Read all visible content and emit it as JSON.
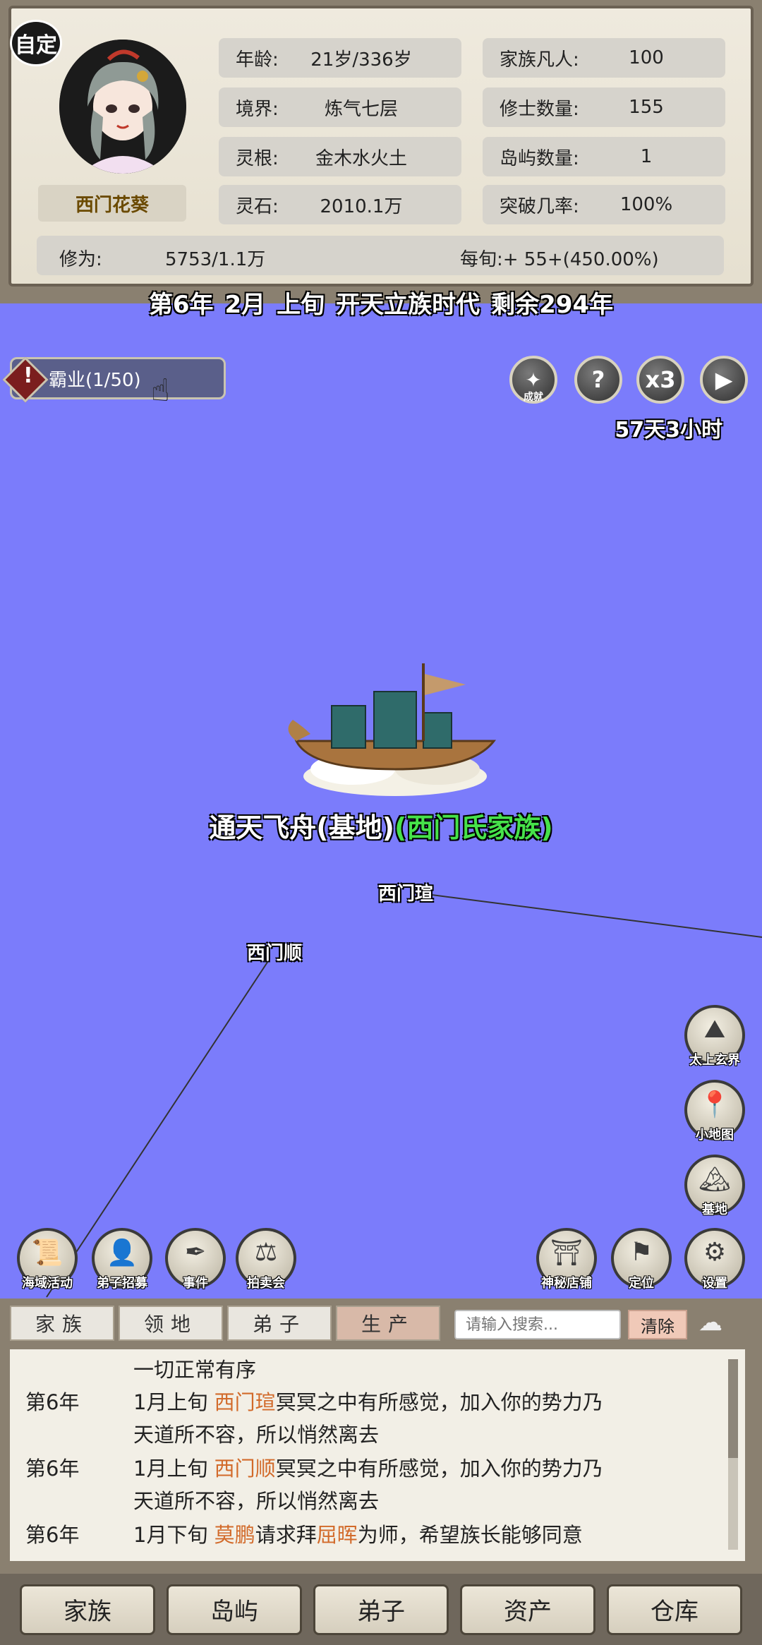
{
  "profile": {
    "custom_badge": "自定",
    "name": "西门花葵"
  },
  "stats": {
    "age_label": "年龄:",
    "age_value": "21岁/336岁",
    "realm_label": "境界:",
    "realm_value": "炼气七层",
    "root_label": "灵根:",
    "root_value": "金木水火土",
    "stone_label": "灵石:",
    "stone_value": "2010.1万",
    "mortals_label": "家族凡人:",
    "mortals_value": "100",
    "cultivators_label": "修士数量:",
    "cultivators_value": "155",
    "islands_label": "岛屿数量:",
    "islands_value": "1",
    "breakthrough_label": "突破几率:",
    "breakthrough_value": "100%",
    "cultivation_label": "修为:",
    "cultivation_value": "5753/1.1万",
    "per_period_label": "每旬:+ 55+(450.00%)"
  },
  "date": {
    "year": "第6年",
    "month": "2月",
    "period": "上旬",
    "era": "开天立族时代",
    "remaining": "剩余294年"
  },
  "quest": {
    "label": "霸业(1/50)"
  },
  "top_buttons": {
    "achievement_caption": "成就",
    "help_symbol": "?",
    "speed": "x3",
    "play_symbol": "▶",
    "timer": "57天3小时"
  },
  "map": {
    "base_name": "通天飞舟(基地)",
    "clan_name": "(西门氏家族)",
    "npc_1": "西门瑄",
    "npc_2": "西门顺"
  },
  "side_buttons": {
    "realm": "太上玄界",
    "minimap": "小地图",
    "base": "基地"
  },
  "action_buttons": {
    "sea_activity": "海域活动",
    "recruit": "弟子招募",
    "events": "事件",
    "auction": "拍卖会",
    "shop": "神秘店铺",
    "locate": "定位",
    "settings": "设置"
  },
  "log_tabs": [
    "家族",
    "领地",
    "弟子",
    "生产"
  ],
  "search": {
    "placeholder": "请输入搜索...",
    "clear": "清除"
  },
  "log": {
    "line0": "一切正常有序",
    "row1_year": "第6年",
    "row1_a": "1月上旬 ",
    "row1_name": "西门瑄",
    "row1_b": "冥冥之中有所感觉，加入你的势力乃",
    "row1_c": "天道所不容，所以悄然离去",
    "row2_year": "第6年",
    "row2_a": "1月上旬 ",
    "row2_name": "西门顺",
    "row2_b": "冥冥之中有所感觉，加入你的势力乃",
    "row2_c": "天道所不容，所以悄然离去",
    "row3_year": "第6年",
    "row3_a": "1月下旬 ",
    "row3_name1": "莫鹏",
    "row3_b": "请求拜",
    "row3_name2": "屈晖",
    "row3_c": "为师，希望族长能够同意"
  },
  "nav": [
    "家族",
    "岛屿",
    "弟子",
    "资产",
    "仓库"
  ],
  "colors": {
    "sea": "#7b7cfb",
    "clan_green": "#46e24a",
    "highlight": "#d26a2a"
  }
}
